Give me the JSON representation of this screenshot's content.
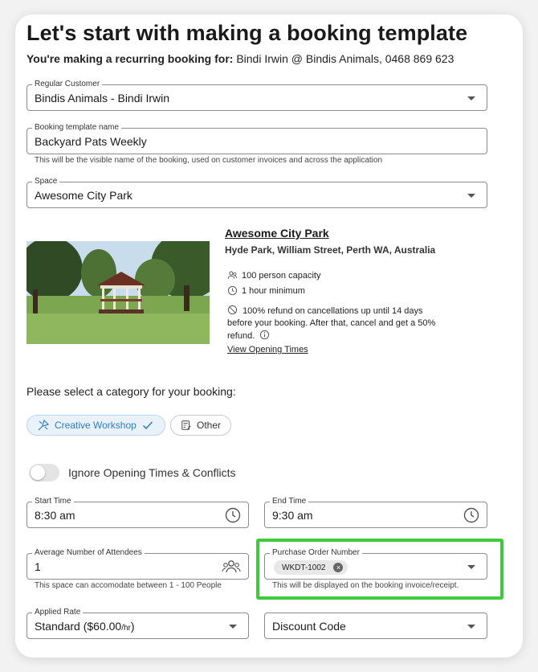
{
  "header": {
    "title": "Let's start with making a booking template",
    "subtitle_prefix": "You're making a recurring booking for:",
    "subtitle_value": " Bindi Irwin @ Bindis Animals, 0468 869 623"
  },
  "form": {
    "regular_customer": {
      "label": "Regular Customer",
      "value": "Bindis Animals - Bindi Irwin"
    },
    "template_name": {
      "label": "Booking template name",
      "value": "Backyard Pats Weekly",
      "helper": "This will be the visible name of the booking, used on customer invoices and across the application"
    },
    "space": {
      "label": "Space",
      "value": "Awesome City Park"
    }
  },
  "venue": {
    "name": "Awesome City Park",
    "address": "Hyde Park, William Street, Perth WA, Australia",
    "capacity": "100 person capacity",
    "minimum": "1 hour minimum",
    "refund": "100% refund on cancellations up until 14 days before your booking. After that, cancel and get a 50% refund.",
    "opening_link": "View Opening Times"
  },
  "category": {
    "prompt": "Please select a category for your booking:",
    "options": [
      {
        "label": "Creative Workshop",
        "selected": true
      },
      {
        "label": "Other",
        "selected": false
      }
    ]
  },
  "toggle": {
    "label": "Ignore Opening Times & Conflicts",
    "on": false
  },
  "times": {
    "start": {
      "label": "Start Time",
      "value": "8:30 am"
    },
    "end": {
      "label": "End Time",
      "value": "9:30 am"
    }
  },
  "attendees": {
    "label": "Average Number of Attendees",
    "value": "1",
    "helper": "This space can accomodate between 1 - 100 People"
  },
  "purchase_order": {
    "label": "Purchase Order Number",
    "chip": "WKDT-1002",
    "helper": "This will be displayed on the booking invoice/receipt."
  },
  "rate": {
    "label": "Applied Rate",
    "value": "Standard  ($60.00",
    "unit": "/hr",
    "close": ")"
  },
  "discount": {
    "placeholder": "Discount Code"
  },
  "colors": {
    "accent": "#2d7bc4",
    "highlight": "#3dcb3d",
    "chip_bg": "#e9f2fb"
  }
}
